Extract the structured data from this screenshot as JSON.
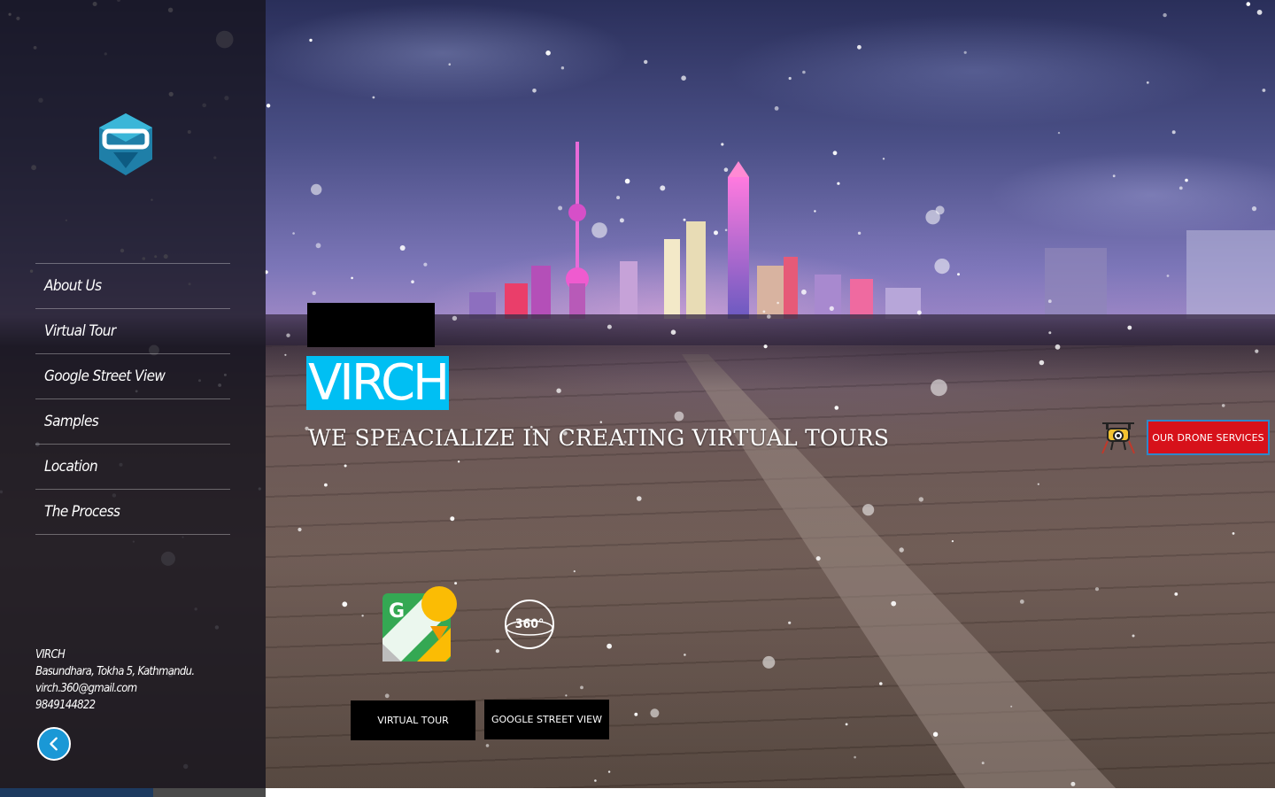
{
  "brand": {
    "name": "VIRCH",
    "tagline": "WE SPEACIALIZE IN CREATING VIRTUAL TOURS"
  },
  "sidebar": {
    "logo": "virch-logo",
    "nav": [
      {
        "label": "About Us"
      },
      {
        "label": "Virtual Tour"
      },
      {
        "label": "Google Street View"
      },
      {
        "label": "Samples"
      },
      {
        "label": "Location"
      },
      {
        "label": "The Process"
      }
    ],
    "contact": {
      "name": "VIRCH",
      "address": "Basundhara, Tokha 5, Kathmandu.",
      "email": "virch.360@gmail.com",
      "phone": "9849144822"
    },
    "back_icon": "chevron-left-icon"
  },
  "hero": {
    "drone_button": "OUR DRONE SERVICES",
    "drone_icon": "drone-icon",
    "gsv_icon": "google-street-view-icon",
    "vt_icon": "360-icon",
    "vt_icon_text": "360°",
    "virtual_tour_button": "VIRTUAL TOUR",
    "street_view_button": "GOOGLE STREET VIEW"
  },
  "colors": {
    "accent": "#00bff3",
    "drone_button_bg": "#d7111a",
    "back_button_bg": "#1a98d6",
    "sidebar_bg": "#16141e"
  }
}
